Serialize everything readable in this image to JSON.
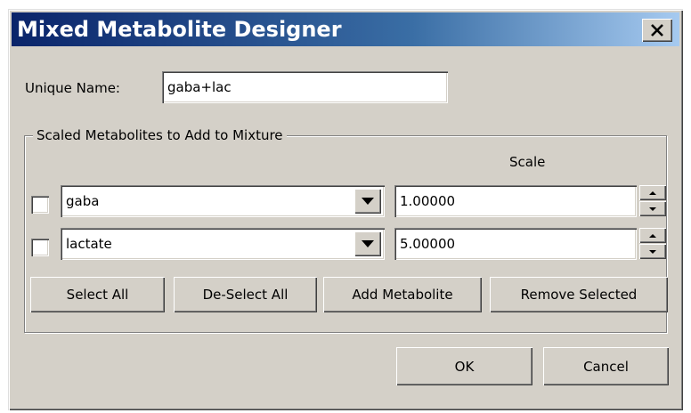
{
  "window": {
    "title": "Mixed Metabolite Designer",
    "close_label": "×"
  },
  "unique_name": {
    "label": "Unique Name:",
    "value": "gaba+lac"
  },
  "group": {
    "legend": "Scaled Metabolites to Add to Mixture",
    "scale_header": "Scale",
    "rows": [
      {
        "checked": false,
        "metabolite": "gaba",
        "scale": "1.00000"
      },
      {
        "checked": false,
        "metabolite": "lactate",
        "scale": "5.00000"
      }
    ],
    "buttons": {
      "select_all": "Select All",
      "deselect_all": "De-Select All",
      "add_metabolite": "Add Metabolite",
      "remove_selected": "Remove Selected"
    }
  },
  "footer": {
    "ok": "OK",
    "cancel": "Cancel"
  },
  "icons": {
    "close": "close-icon",
    "dropdown": "chevron-down-icon",
    "spin_up": "spin-up-icon",
    "spin_down": "spin-down-icon"
  },
  "colors": {
    "title_start": "#0a246a",
    "title_end": "#a6caf0",
    "face": "#d4d0c8"
  }
}
